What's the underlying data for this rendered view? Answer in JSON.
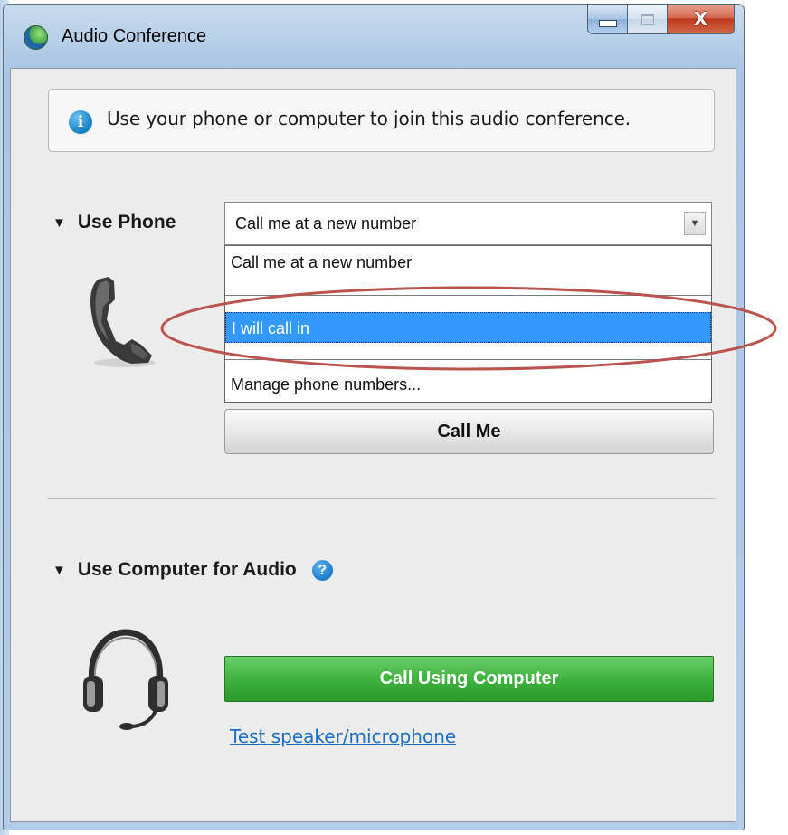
{
  "window": {
    "title": "Audio Conference",
    "close_glyph": "X"
  },
  "info": {
    "icon": "i",
    "text": "Use your phone or computer to join this audio conference."
  },
  "phone_section": {
    "toggle": "▼",
    "title": "Use Phone",
    "select_value": "Call me at a new number",
    "dropdown_options": [
      "Call me at a new number",
      "I will call in",
      "Manage phone numbers..."
    ],
    "selected_index": 1,
    "call_me_label": "Call Me"
  },
  "computer_section": {
    "toggle": "▼",
    "title": "Use Computer for Audio",
    "help": "?",
    "call_button_label": "Call Using Computer",
    "test_link": "Test speaker/microphone"
  },
  "colors": {
    "highlight": "#3399ff",
    "call_button": "#3fb23f",
    "annotation_ellipse": "#b9544f",
    "link": "#1a6fc3"
  }
}
